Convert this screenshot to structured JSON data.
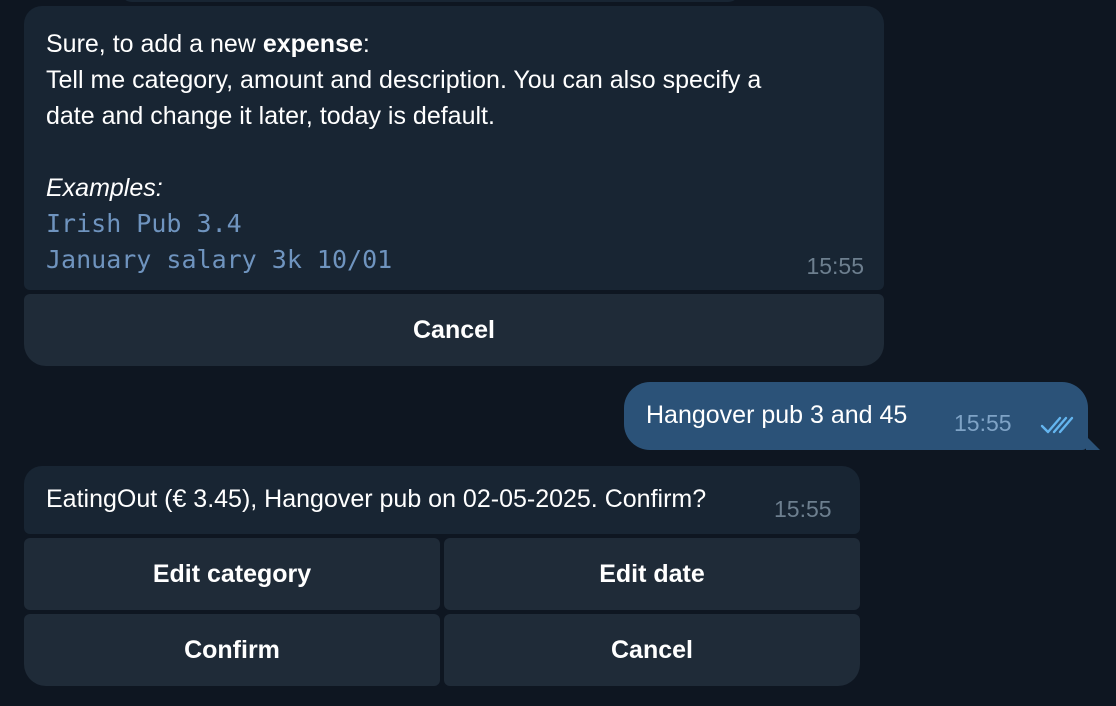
{
  "messages": {
    "bot_prompt": {
      "line1_prefix": "Sure, to add a new ",
      "line1_bold": "expense",
      "line1_suffix": ":",
      "line2": "Tell me category, amount and description. You can also specify a",
      "line3": "date and change it later, today is default.",
      "examples_label": "Examples:",
      "example1": "Irish Pub 3.4",
      "example2": "January salary 3k 10/01",
      "time": "15:55"
    },
    "bot_prompt_buttons": {
      "cancel": "Cancel"
    },
    "user_reply": {
      "text": "Hangover pub 3 and 45",
      "time": "15:55",
      "status_icon": "double-check-icon"
    },
    "bot_confirm": {
      "text": "EatingOut (€ 3.45), Hangover pub on 02-05-2025. Confirm?",
      "time": "15:55"
    },
    "bot_confirm_buttons": {
      "edit_category": "Edit category",
      "edit_date": "Edit date",
      "confirm": "Confirm",
      "cancel": "Cancel"
    }
  },
  "colors": {
    "background": "#0e1621",
    "incoming_bubble": "#182533",
    "outgoing_bubble": "#2b5278",
    "keyboard_button": "#1f2b38",
    "code_text": "#6f94bf",
    "timestamp": "#6d7f8f",
    "read_ticks": "#64b5ef"
  }
}
